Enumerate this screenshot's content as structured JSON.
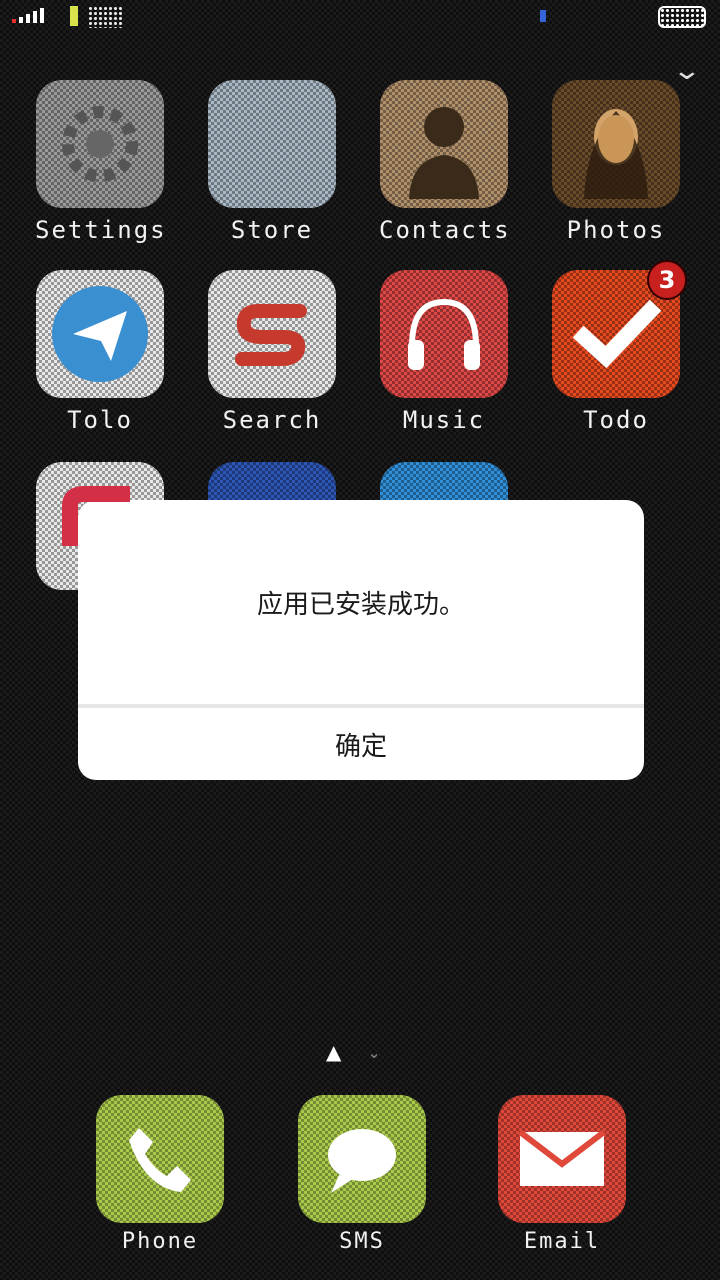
{
  "status_bar": {
    "signal_icon": "signal-icon",
    "wifi_icon": "wifi-icon",
    "battery_icon": "battery-icon"
  },
  "apps_row1": [
    {
      "label": "Settings",
      "color": "#9a9a9a",
      "icon": "gear-icon"
    },
    {
      "label": "Store",
      "color": "#a9b8c4",
      "icon": "store-icon"
    },
    {
      "label": "Contacts",
      "color": "#b0906a",
      "icon": "contact-icon"
    },
    {
      "label": "Photos",
      "color": "#6a4c2a",
      "icon": "photo-icon"
    }
  ],
  "apps_row2": [
    {
      "label": "Tolo",
      "color": "#3a8fd0",
      "icon": "send-icon"
    },
    {
      "label": "Search",
      "color": "#e8e8e8",
      "icon": "search-s-icon"
    },
    {
      "label": "Music",
      "color": "#e04848",
      "icon": "headphones-icon"
    },
    {
      "label": "Todo",
      "color": "#e84a20",
      "icon": "check-icon",
      "badge": "3"
    }
  ],
  "apps_row3": [
    {
      "color": "#d33048",
      "icon": "app-icon"
    },
    {
      "color": "#2c57b8",
      "icon": "app-icon"
    },
    {
      "color": "#2f8fd8",
      "icon": "app-icon"
    }
  ],
  "dock": [
    {
      "label": "Phone",
      "color": "#a9c94a",
      "icon": "phone-icon"
    },
    {
      "label": "SMS",
      "color": "#a9c94a",
      "icon": "message-icon"
    },
    {
      "label": "Email",
      "color": "#e0483a",
      "icon": "mail-icon"
    }
  ],
  "dialog": {
    "message": "应用已安装成功。",
    "ok_label": "确定"
  }
}
